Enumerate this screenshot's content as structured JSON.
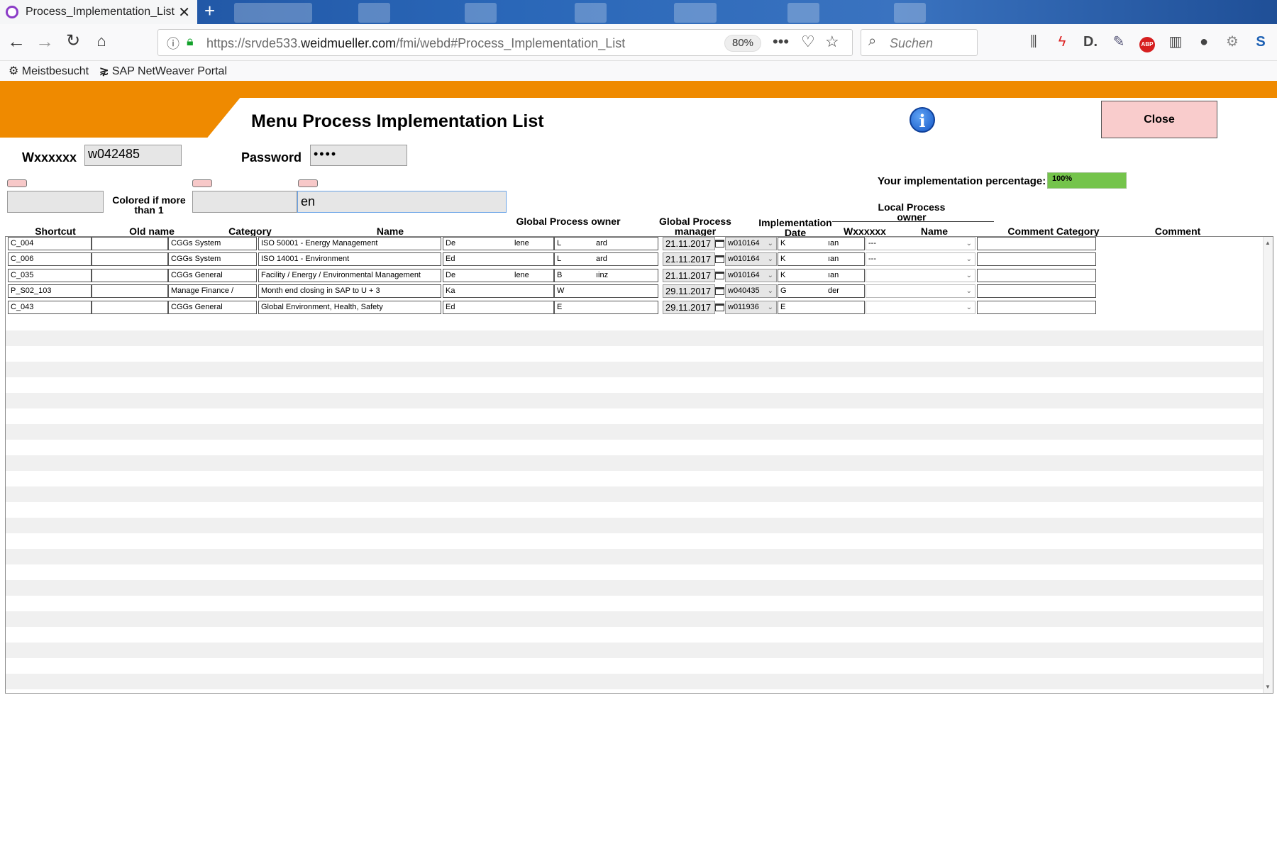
{
  "browser": {
    "tab_title": "Process_Implementation_List (F",
    "tab_close": "✕",
    "new_tab": "+",
    "url_prefix": "https://srvde533.",
    "url_domain": "weidmueller.com",
    "url_path": "/fmi/webd#Process_Implementation_List",
    "zoom": "80%",
    "search_placeholder": "Suchen",
    "bookmarks": [
      {
        "label": "Meistbesucht",
        "icon": "gear-icon"
      },
      {
        "label": "SAP NetWeaver Portal",
        "icon": "sap-icon"
      }
    ]
  },
  "app": {
    "title": "Menu Process Implementation List",
    "close_label": "Close",
    "user_label": "Wxxxxxx",
    "user_value": "w042485",
    "password_label": "Password",
    "password_value": "••••",
    "percentage_label": "Your implementation percentage:",
    "percentage_value": "100%",
    "percentage_fraction": 1.0,
    "colored_note": "Colored if more than 1",
    "filter_name_value": "en",
    "accent_color": "#ef8a00"
  },
  "headers": {
    "shortcut": "Shortcut",
    "old_name": "Old name",
    "category": "Category",
    "name": "Name",
    "global_owner": "Global Process owner",
    "global_manager": "Global Process manager",
    "impl_date": "Implementation Date",
    "local_owner": "Local Process owner",
    "wx": "Wxxxxxx",
    "local_name": "Name",
    "comment_category": "Comment Category",
    "comment": "Comment"
  },
  "rows": [
    {
      "shortcut": "C_004",
      "old_name": "",
      "category": "CGGs System",
      "name": "ISO 50001 - Energy Management",
      "gpo_a": "De",
      "gpo_b": "lene",
      "gpm_a": "L",
      "gpm_b": "ard",
      "date": "21.11.2017",
      "wx": "w010164",
      "ln_a": "K",
      "ln_b": "ıan",
      "comment_category": "---",
      "comment": ""
    },
    {
      "shortcut": "C_006",
      "old_name": "",
      "category": "CGGs System",
      "name": "ISO 14001 - Environment",
      "gpo_a": "Ed",
      "gpo_b": "",
      "gpm_a": "L",
      "gpm_b": "ard",
      "date": "21.11.2017",
      "wx": "w010164",
      "ln_a": "K",
      "ln_b": "ıan",
      "comment_category": "---",
      "comment": ""
    },
    {
      "shortcut": "C_035",
      "old_name": "",
      "category": "CGGs General",
      "name": "Facility / Energy / Environmental Management",
      "gpo_a": "De",
      "gpo_b": "lene",
      "gpm_a": "B",
      "gpm_b": "ıinz",
      "date": "21.11.2017",
      "wx": "w010164",
      "ln_a": "K",
      "ln_b": "ıan",
      "comment_category": "",
      "comment": ""
    },
    {
      "shortcut": "P_S02_103",
      "old_name": "",
      "category": "Manage Finance /",
      "name": "Month end closing in SAP to U + 3",
      "gpo_a": "Ka",
      "gpo_b": "",
      "gpm_a": "W",
      "gpm_b": "",
      "date": "29.11.2017",
      "wx": "w040435",
      "ln_a": "G",
      "ln_b": "der",
      "comment_category": "",
      "comment": ""
    },
    {
      "shortcut": "C_043",
      "old_name": "",
      "category": "CGGs General",
      "name": "Global Environment, Health, Safety",
      "gpo_a": "Ed",
      "gpo_b": "",
      "gpm_a": "E",
      "gpm_b": "",
      "date": "29.11.2017",
      "wx": "w011936",
      "ln_a": "E",
      "ln_b": "",
      "comment_category": "",
      "comment": ""
    }
  ]
}
